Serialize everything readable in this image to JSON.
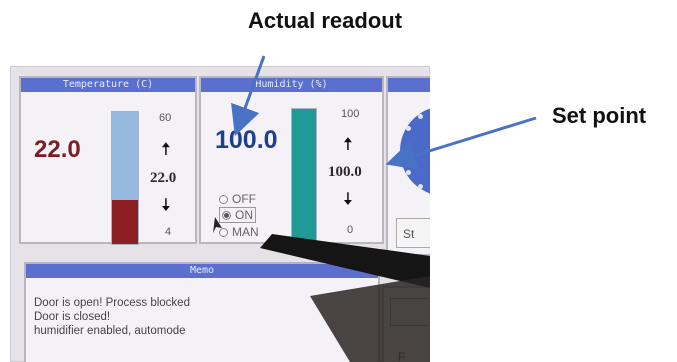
{
  "annotations": {
    "actual_readout": "Actual readout",
    "set_point": "Set point"
  },
  "temperature": {
    "title": "Temperature (C)",
    "value": "22.0",
    "scale_max": "60",
    "setpoint": "22.0",
    "scale_min": "4"
  },
  "humidity": {
    "title": "Humidity (%)",
    "value": "100.0",
    "scale_max": "100",
    "setpoint": "100.0",
    "scale_min": "0",
    "fill_percent": 100,
    "modes": [
      "OFF",
      "ON",
      "MAN"
    ],
    "selected_mode": "ON"
  },
  "memo": {
    "title": "Memo",
    "lines": [
      "Door is open! Process blocked",
      "Door is closed!",
      "humidifier enabled, automode"
    ]
  },
  "right_panel": {
    "button_label": "St"
  },
  "side_panel": {
    "button_label": "F"
  },
  "colors": {
    "panel_title": "#5b6fcf",
    "temp_bar_upper": "#96b9e0",
    "temp_bar_lower": "#8c1d22",
    "hum_bar": "#1f9a97",
    "annotation_arrow": "#4a72c4"
  }
}
